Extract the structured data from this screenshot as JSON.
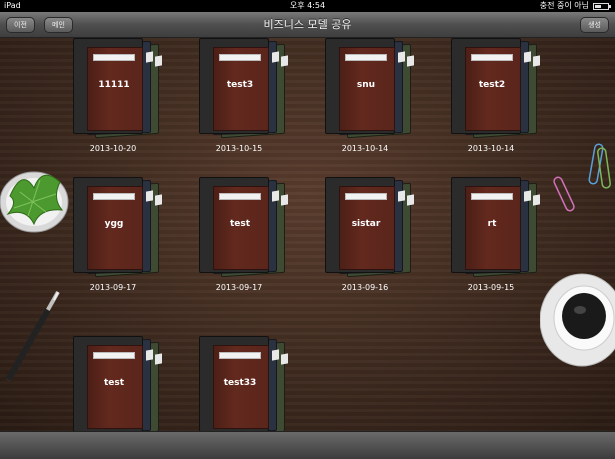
{
  "status_bar": {
    "device": "iPad",
    "time": "오후 4:54",
    "right_text": "충전 중이 아님"
  },
  "nav": {
    "title": "비즈니스 모델 공유",
    "left_buttons": [
      "이전",
      "메인"
    ],
    "right_button": "생성"
  },
  "projects": [
    {
      "name": "11111",
      "date": "2013-10-20"
    },
    {
      "name": "test3",
      "date": "2013-10-15"
    },
    {
      "name": "snu",
      "date": "2013-10-14"
    },
    {
      "name": "test2",
      "date": "2013-10-14"
    },
    {
      "name": "ygg",
      "date": "2013-09-17"
    },
    {
      "name": "test",
      "date": "2013-09-17"
    },
    {
      "name": "sistar",
      "date": "2013-09-16"
    },
    {
      "name": "rt",
      "date": "2013-09-15"
    },
    {
      "name": "test",
      "date": ""
    },
    {
      "name": "test33",
      "date": ""
    }
  ],
  "decor": {
    "plant_icon": "plant-bowl-icon",
    "pen_icon": "pen-icon",
    "cup_icon": "coffee-cup-icon",
    "clips_icon": "paper-clips-icon"
  }
}
